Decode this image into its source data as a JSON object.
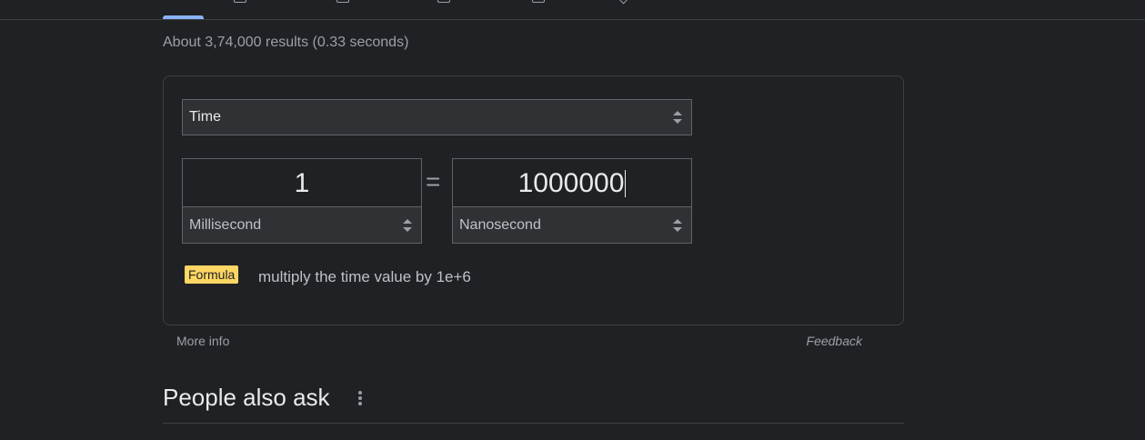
{
  "search": {
    "result_stats": "About 3,74,000 results (0.33 seconds)"
  },
  "converter": {
    "category": "Time",
    "from_value": "1",
    "from_unit": "Millisecond",
    "equals": "=",
    "to_value": "1000000",
    "to_unit": "Nanosecond",
    "formula_label": "Formula",
    "formula_text": "multiply the time value by 1e+6",
    "more_info": "More info",
    "feedback": "Feedback"
  },
  "people_also_ask": {
    "title": "People also ask"
  },
  "colors": {
    "background": "#202124",
    "active_tab": "#8ab4f8",
    "formula_badge": "#fdd663"
  },
  "icons": [
    "search-icon",
    "images-icon",
    "news-icon",
    "videos-icon",
    "shopping-icon",
    "more-icon",
    "updown-arrows-icon",
    "kebab-menu-icon"
  ]
}
